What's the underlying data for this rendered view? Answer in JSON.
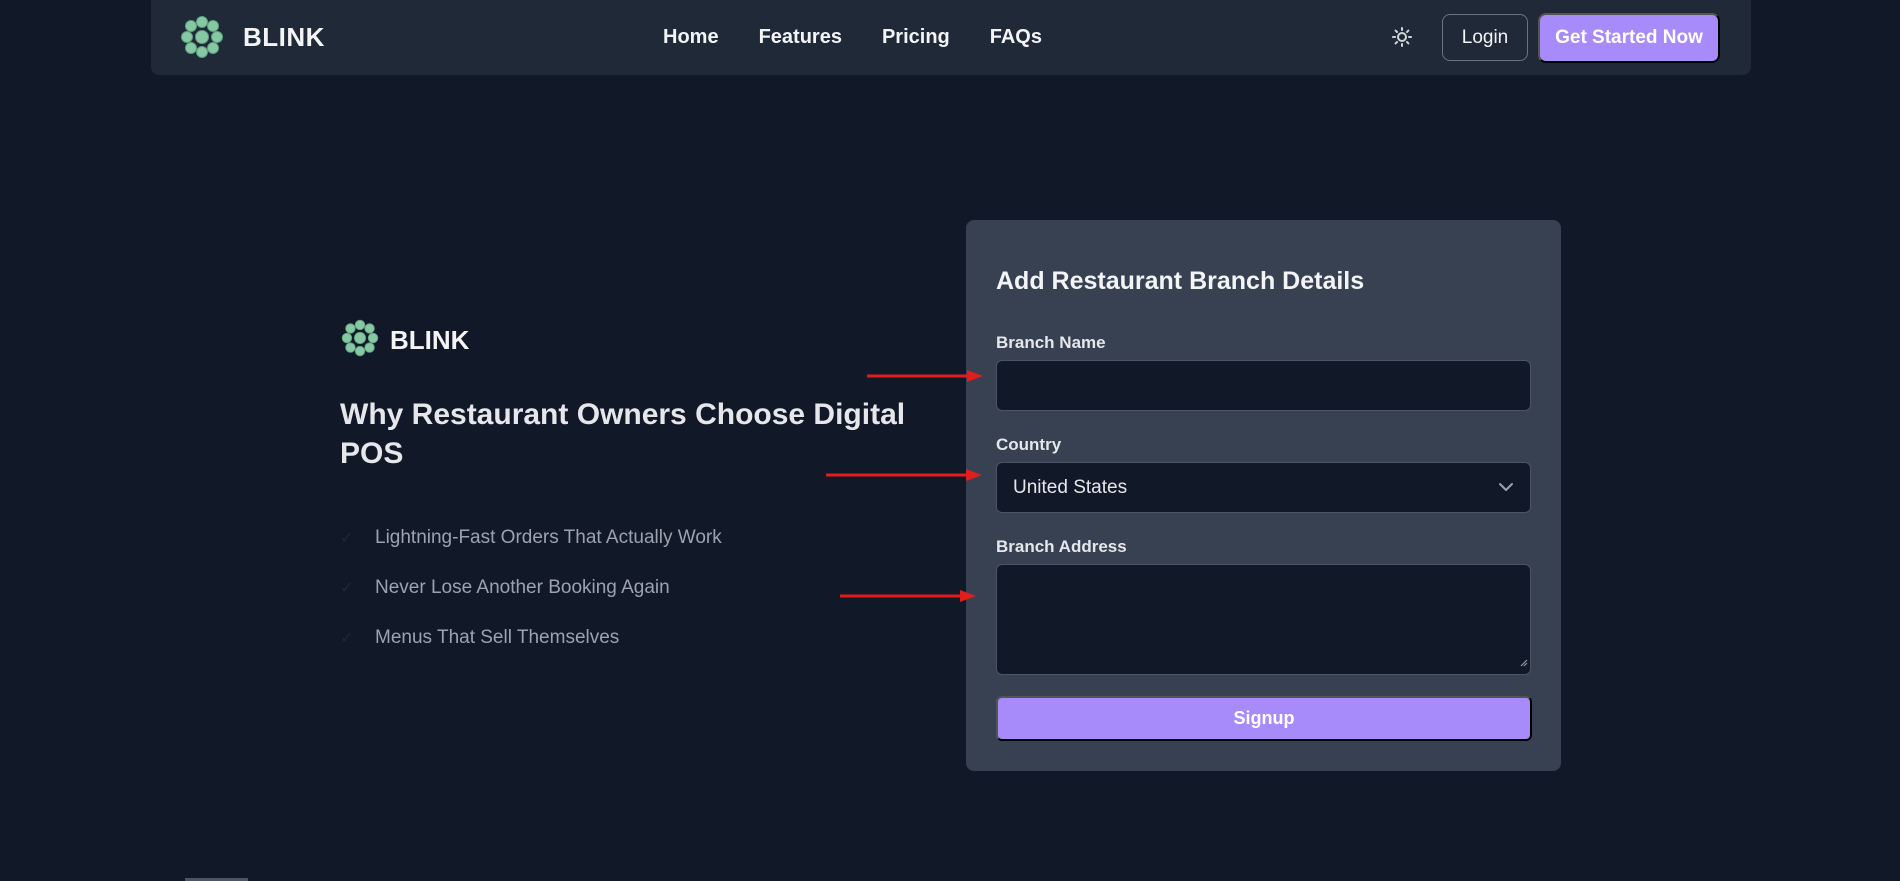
{
  "navbar": {
    "brand": "BLINK",
    "links": [
      "Home",
      "Features",
      "Pricing",
      "FAQs"
    ],
    "theme_icon": "sun-icon",
    "login_label": "Login",
    "cta_label": "Get Started Now"
  },
  "intro": {
    "brand": "BLINK",
    "headline": "Why Restaurant Owners Choose Digital POS",
    "features": [
      "Lightning-Fast Orders That Actually Work",
      "Never Lose Another Booking Again",
      "Menus That Sell Themselves"
    ]
  },
  "form": {
    "title": "Add Restaurant Branch Details",
    "branch_name_label": "Branch Name",
    "branch_name_value": "",
    "country_label": "Country",
    "country_value": "United States",
    "branch_address_label": "Branch Address",
    "branch_address_value": "",
    "submit_label": "Signup"
  },
  "colors": {
    "background": "#111827",
    "navbar": "#1f2937",
    "card": "#374151",
    "accent": "#a78bfa",
    "annotation_arrow": "#e11d1d"
  }
}
